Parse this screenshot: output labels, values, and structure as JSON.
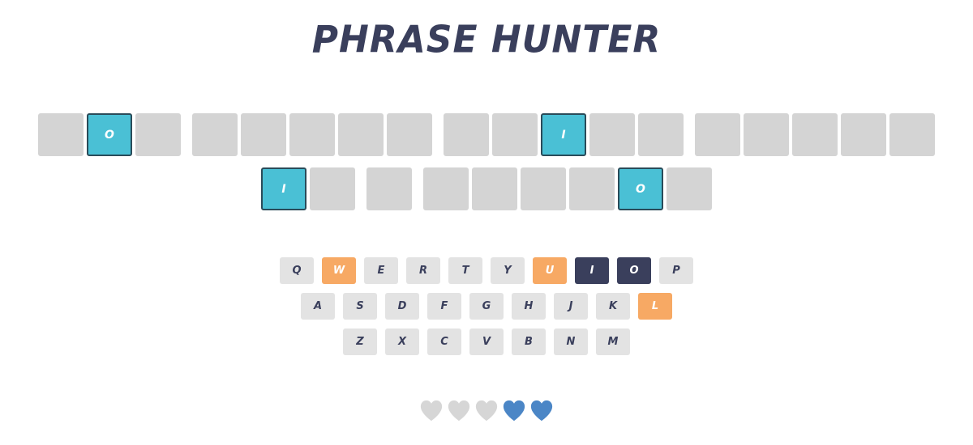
{
  "game": {
    "title": "PHRASE HUNTER"
  },
  "phrase": {
    "lines": [
      [
        [
          {
            "letter": "",
            "shown": false
          },
          {
            "letter": "O",
            "shown": true
          },
          {
            "letter": "",
            "shown": false
          }
        ],
        [
          {
            "letter": "",
            "shown": false
          },
          {
            "letter": "",
            "shown": false
          },
          {
            "letter": "",
            "shown": false
          },
          {
            "letter": "",
            "shown": false
          },
          {
            "letter": "",
            "shown": false
          }
        ],
        [
          {
            "letter": "",
            "shown": false
          },
          {
            "letter": "",
            "shown": false
          },
          {
            "letter": "I",
            "shown": true
          },
          {
            "letter": "",
            "shown": false
          },
          {
            "letter": "",
            "shown": false
          }
        ],
        [
          {
            "letter": "",
            "shown": false
          },
          {
            "letter": "",
            "shown": false
          },
          {
            "letter": "",
            "shown": false
          },
          {
            "letter": "",
            "shown": false
          },
          {
            "letter": "",
            "shown": false
          }
        ]
      ],
      [
        [
          {
            "letter": "I",
            "shown": true
          },
          {
            "letter": "",
            "shown": false
          }
        ],
        [
          {
            "letter": "",
            "shown": false
          }
        ],
        [
          {
            "letter": "",
            "shown": false
          },
          {
            "letter": "",
            "shown": false
          },
          {
            "letter": "",
            "shown": false
          },
          {
            "letter": "",
            "shown": false
          },
          {
            "letter": "O",
            "shown": true
          },
          {
            "letter": "",
            "shown": false
          }
        ]
      ]
    ]
  },
  "keyboard": {
    "rows": [
      [
        {
          "label": "Q",
          "state": "default"
        },
        {
          "label": "W",
          "state": "wrong"
        },
        {
          "label": "E",
          "state": "default"
        },
        {
          "label": "R",
          "state": "default"
        },
        {
          "label": "T",
          "state": "default"
        },
        {
          "label": "Y",
          "state": "default"
        },
        {
          "label": "U",
          "state": "wrong"
        },
        {
          "label": "I",
          "state": "chosen"
        },
        {
          "label": "O",
          "state": "chosen"
        },
        {
          "label": "P",
          "state": "default"
        }
      ],
      [
        {
          "label": "A",
          "state": "default"
        },
        {
          "label": "S",
          "state": "default"
        },
        {
          "label": "D",
          "state": "default"
        },
        {
          "label": "F",
          "state": "default"
        },
        {
          "label": "G",
          "state": "default"
        },
        {
          "label": "H",
          "state": "default"
        },
        {
          "label": "J",
          "state": "default"
        },
        {
          "label": "K",
          "state": "default"
        },
        {
          "label": "L",
          "state": "wrong"
        }
      ],
      [
        {
          "label": "Z",
          "state": "default"
        },
        {
          "label": "X",
          "state": "default"
        },
        {
          "label": "C",
          "state": "default"
        },
        {
          "label": "V",
          "state": "default"
        },
        {
          "label": "B",
          "state": "default"
        },
        {
          "label": "N",
          "state": "default"
        },
        {
          "label": "M",
          "state": "default"
        }
      ]
    ]
  },
  "lives": {
    "icon": "heart-icon",
    "total": 5,
    "remaining": 2,
    "lost_color": "#d6d6d6",
    "live_color": "#4b86c6"
  },
  "colors": {
    "title": "#3a3f5c",
    "tile_hidden": "#d4d4d4",
    "tile_shown": "#4ac0d5",
    "key_default": "#e3e3e3",
    "key_chosen": "#3a3f5c",
    "key_wrong": "#f7a964"
  }
}
